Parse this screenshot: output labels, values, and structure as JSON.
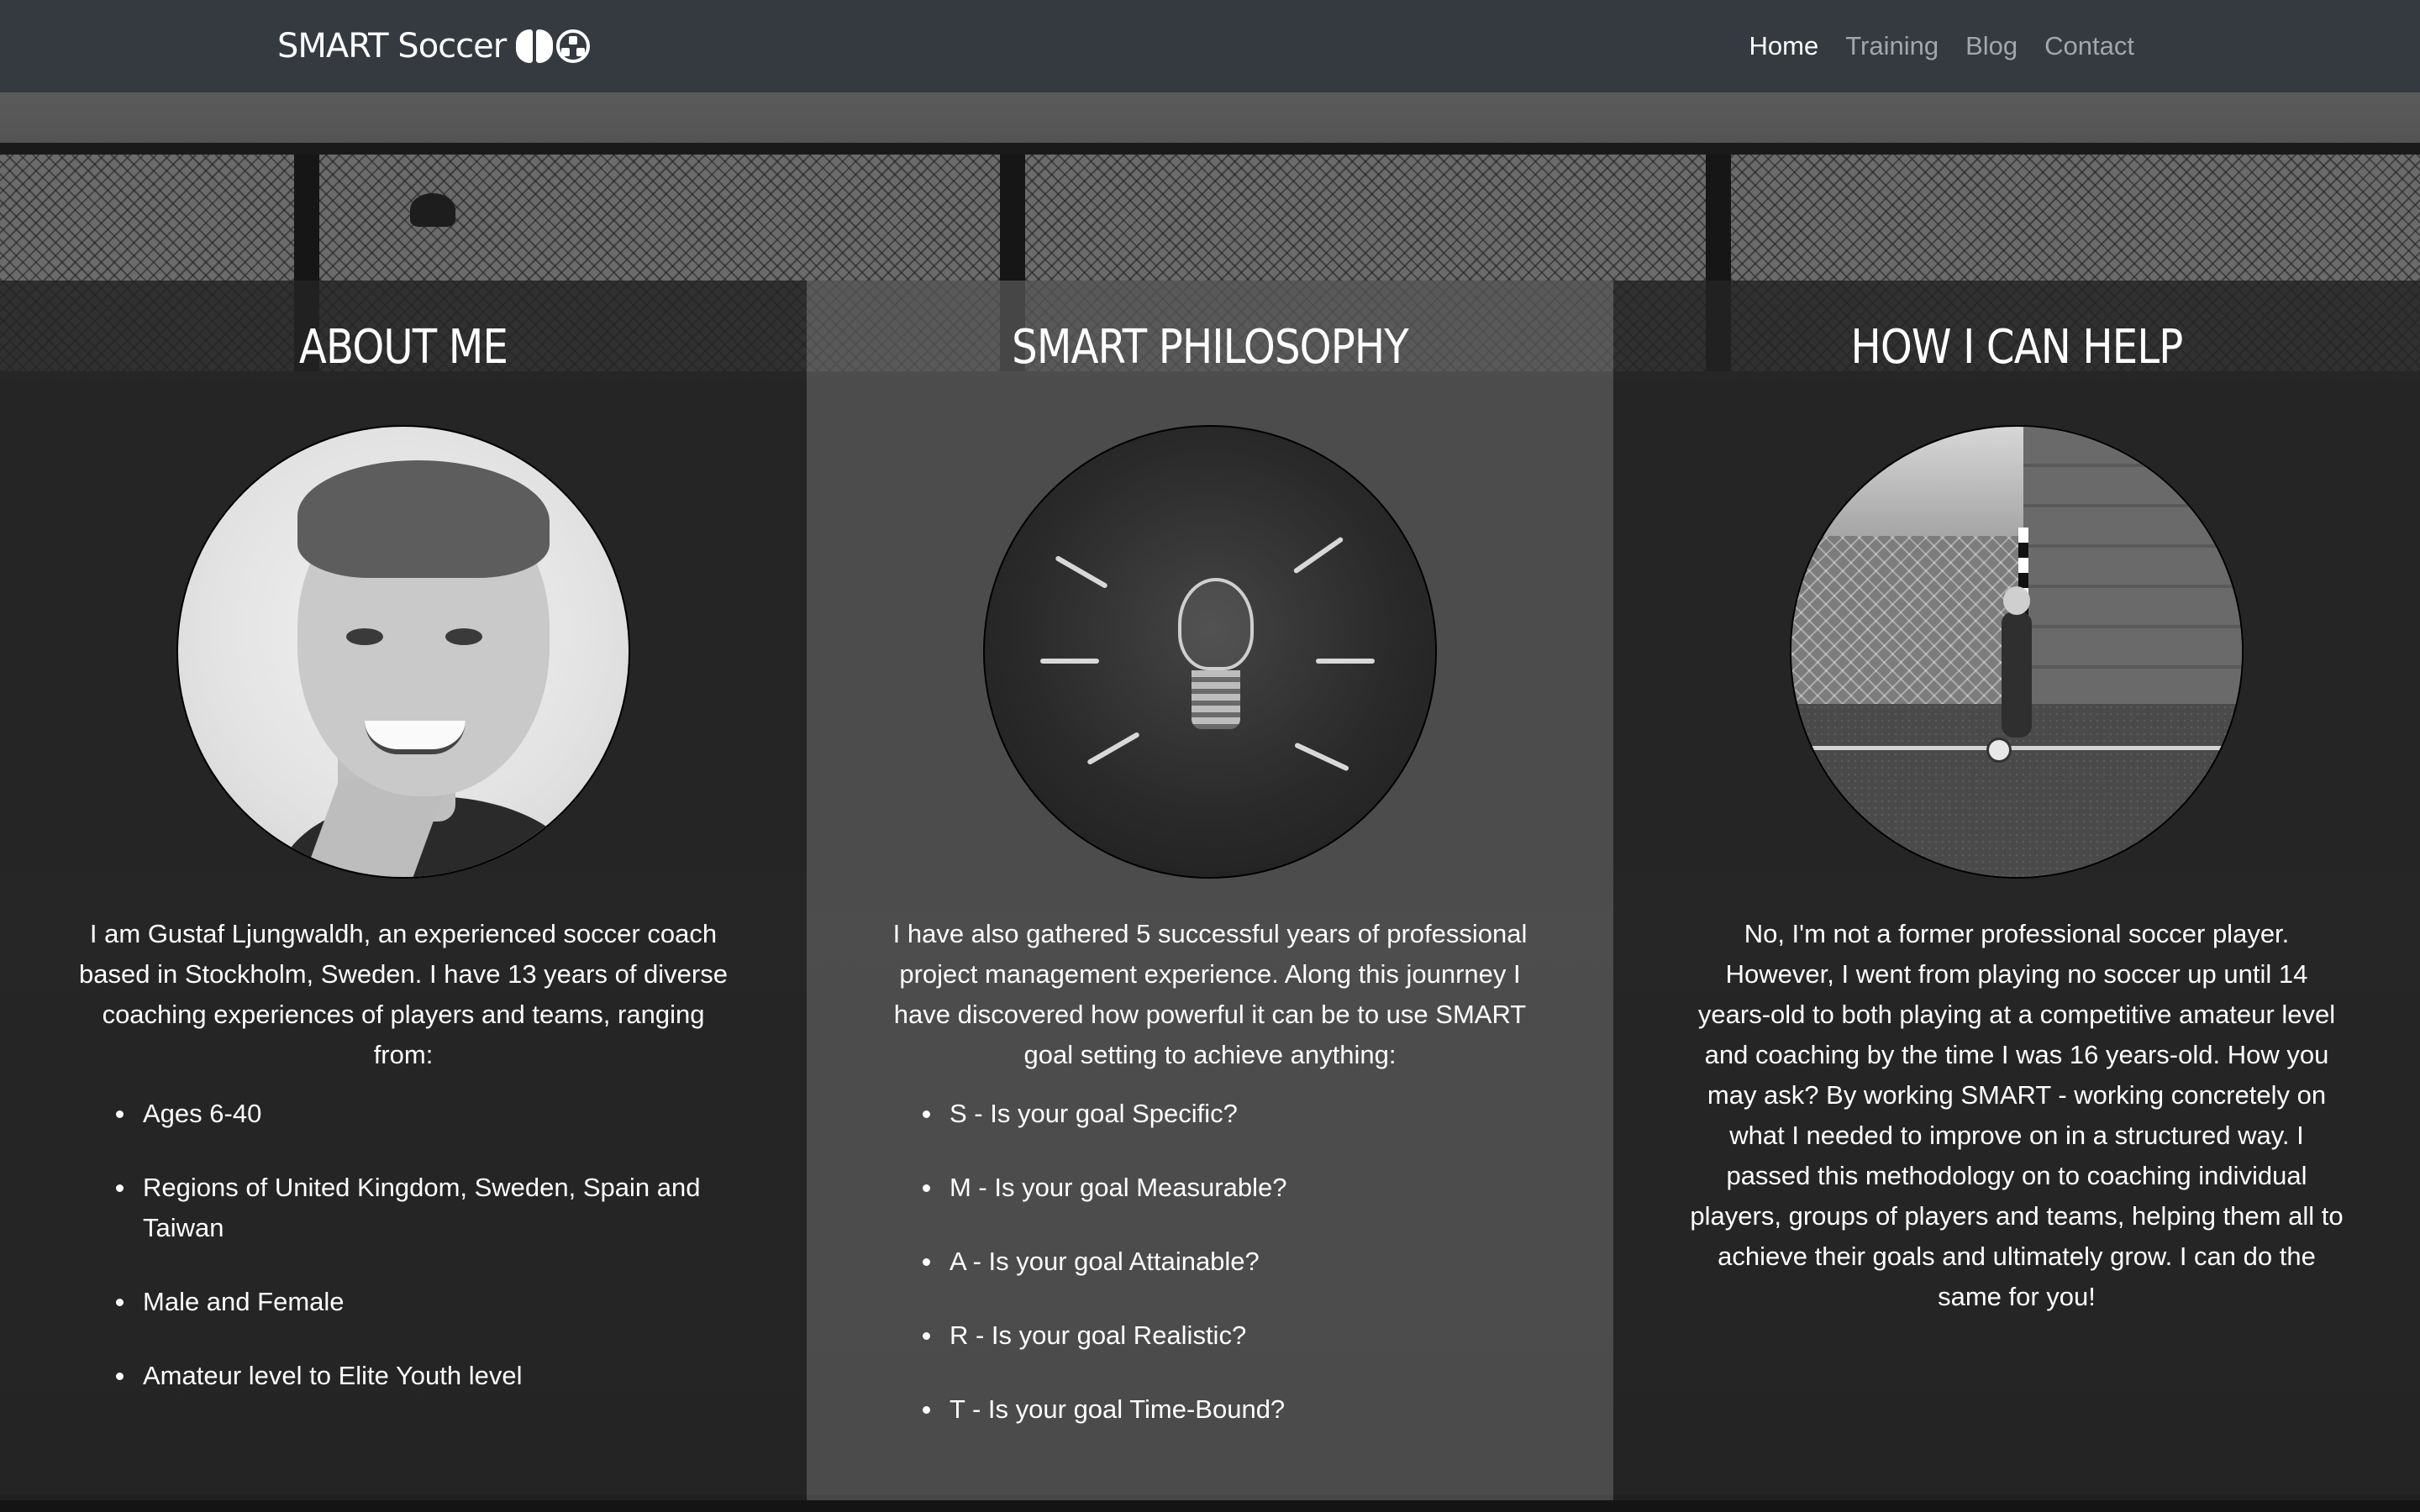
{
  "brand": {
    "name": "SMART Soccer",
    "icons": [
      "brain-icon",
      "soccer-ball-icon"
    ]
  },
  "nav": {
    "items": [
      {
        "label": "Home",
        "active": true
      },
      {
        "label": "Training",
        "active": false
      },
      {
        "label": "Blog",
        "active": false
      },
      {
        "label": "Contact",
        "active": false
      }
    ]
  },
  "colors": {
    "navbar": "#343a40",
    "text": "#ffffff",
    "nav_inactive": "rgba(255,255,255,0.55)"
  },
  "sections": {
    "about": {
      "title": "ABOUT ME",
      "image": "portrait-photo",
      "text": "I am Gustaf Ljungwaldh, an experienced soccer coach based in Stockholm, Sweden. I have 13 years of diverse coaching experiences of players and teams, ranging from:",
      "list": [
        "Ages 6-40",
        "Regions of United Kingdom, Sweden, Spain and Taiwan",
        "Male and Female",
        "Amateur level to Elite Youth level"
      ]
    },
    "philosophy": {
      "title": "SMART PHILOSOPHY",
      "image": "lightbulb-photo",
      "text": "I have also gathered 5 successful years of professional project management experience. Along this jounrney I have discovered how powerful it can be to use SMART goal setting to achieve anything:",
      "list": [
        "S - Is your goal Specific?",
        "M - Is your goal Measurable?",
        "A - Is your goal Attainable?",
        "R - Is your goal Realistic?",
        "T - Is your goal Time-Bound?"
      ]
    },
    "help": {
      "title": "HOW I CAN HELP",
      "image": "child-with-ball-photo",
      "text": "No, I'm not a former professional soccer player. However, I went from playing no soccer up until 14 years-old to both playing at a competitive amateur level and coaching by the time I was 16 years-old. How you may ask? By working SMART - working concretely on what I needed to improve on in a structured way. I passed this methodology on to coaching individual players, groups of players and teams, helping them all to achieve their goals and ultimately grow. I can do the same for you!"
    }
  }
}
